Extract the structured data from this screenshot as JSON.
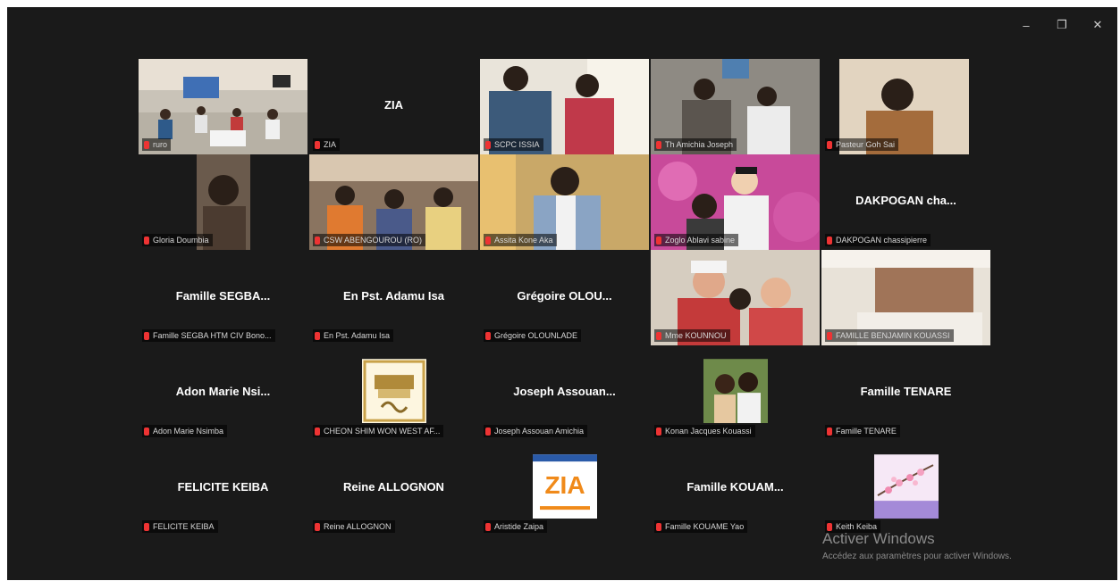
{
  "window": {
    "controls": {
      "minimize": "–",
      "maximize": "❐",
      "close": "✕"
    }
  },
  "tiles": [
    {
      "name": "ruro",
      "type": "video"
    },
    {
      "name": "ZIA",
      "display": "ZIA",
      "type": "name"
    },
    {
      "name": "SCPC ISSIA",
      "type": "video"
    },
    {
      "name": "Th Amichia Joseph",
      "type": "video"
    },
    {
      "name": "Pasteur Goh Sai",
      "type": "video"
    },
    {
      "name": "Gloria Doumbia",
      "type": "video"
    },
    {
      "name": "CSW ABENGOUROU (RO)",
      "type": "video"
    },
    {
      "name": "Assita Kone Aka",
      "type": "video"
    },
    {
      "name": "Zoglo Ablavi sabine",
      "type": "video"
    },
    {
      "name": "DAKPOGAN chassipierre",
      "display": "DAKPOGAN cha...",
      "type": "name"
    },
    {
      "name": "Famille SEGBA HTM CIV Bono...",
      "display": "Famille SEGBA...",
      "type": "name"
    },
    {
      "name": "En Pst. Adamu Isa",
      "display": "En Pst. Adamu Isa",
      "type": "name"
    },
    {
      "name": "Grégoire OLOUNLADE",
      "display": "Grégoire OLOU...",
      "type": "name"
    },
    {
      "name": "Mme KOUNNOU",
      "type": "video"
    },
    {
      "name": "FAMILLE BENJAMIN KOUASSI",
      "type": "video"
    },
    {
      "name": "Adon Marie Nsimba",
      "display": "Adon Marie Nsi...",
      "type": "name"
    },
    {
      "name": "CHEON SHIM WON WEST AF...",
      "type": "avatar",
      "avatar": "logo"
    },
    {
      "name": "Joseph Assouan Amichia",
      "display": "Joseph Assouan...",
      "type": "name"
    },
    {
      "name": "Konan Jacques Kouassi",
      "type": "avatar",
      "avatar": "couple"
    },
    {
      "name": "Famille TENARE",
      "display": "Famille TENARE",
      "type": "name"
    },
    {
      "name": "FELICITE KEIBA",
      "display": "FELICITE KEIBA",
      "type": "name"
    },
    {
      "name": "Reine ALLOGNON",
      "display": "Reine ALLOGNON",
      "type": "name"
    },
    {
      "name": "Aristide Zaipa",
      "type": "avatar",
      "avatar": "zia",
      "avatar_text": "ZIA"
    },
    {
      "name": "Famille KOUAME  Yao",
      "display": "Famille KOUAM...",
      "type": "name"
    },
    {
      "name": "Keith Keiba",
      "type": "avatar",
      "avatar": "blossom"
    }
  ],
  "watermark": {
    "title": "Activer Windows",
    "subtitle": "Accédez aux paramètres pour activer Windows."
  },
  "colors": {
    "background": "#1a1a1a",
    "active_border": "#3ad07a",
    "muted_mic": "#e33333"
  }
}
